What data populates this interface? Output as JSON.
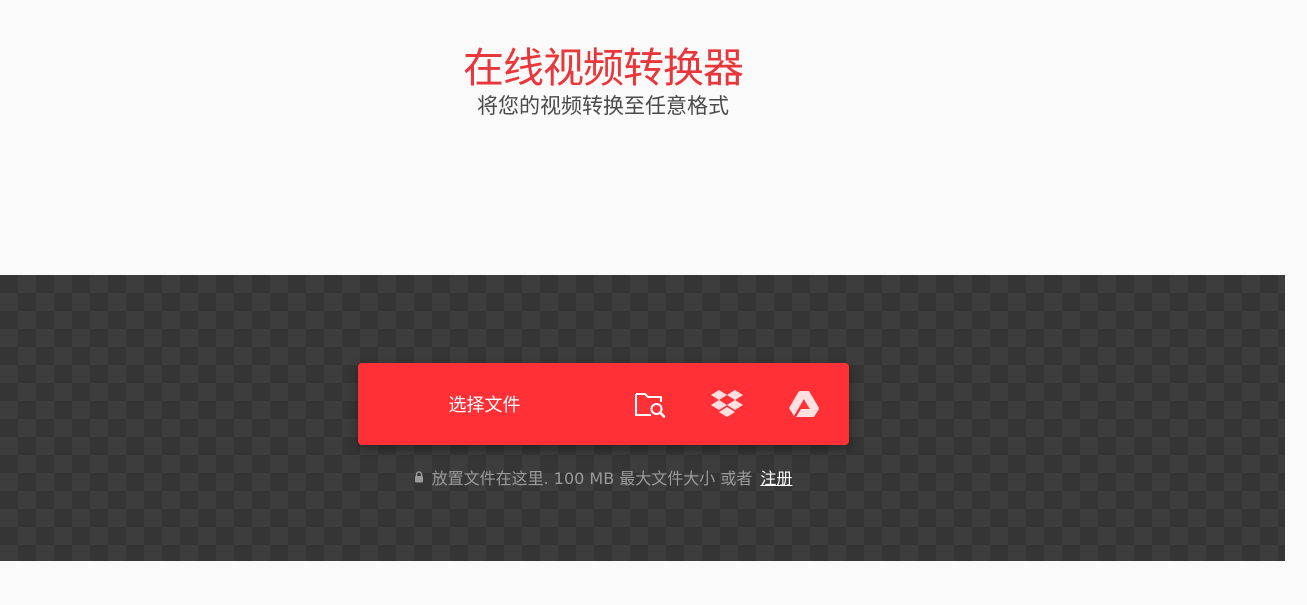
{
  "header": {
    "title": "在线视频转换器",
    "subtitle": "将您的视频转换至任意格式"
  },
  "upload": {
    "choose_label": "选择文件",
    "icons": [
      "folder-search-icon",
      "dropbox-icon",
      "google-drive-icon"
    ],
    "hint_text": "放置文件在这里. 100 MB 最大文件大小 或者",
    "signup_link": "注册"
  },
  "colors": {
    "accent": "#ff3136",
    "title": "#e9363b",
    "dropzone_bg": "#353535"
  }
}
